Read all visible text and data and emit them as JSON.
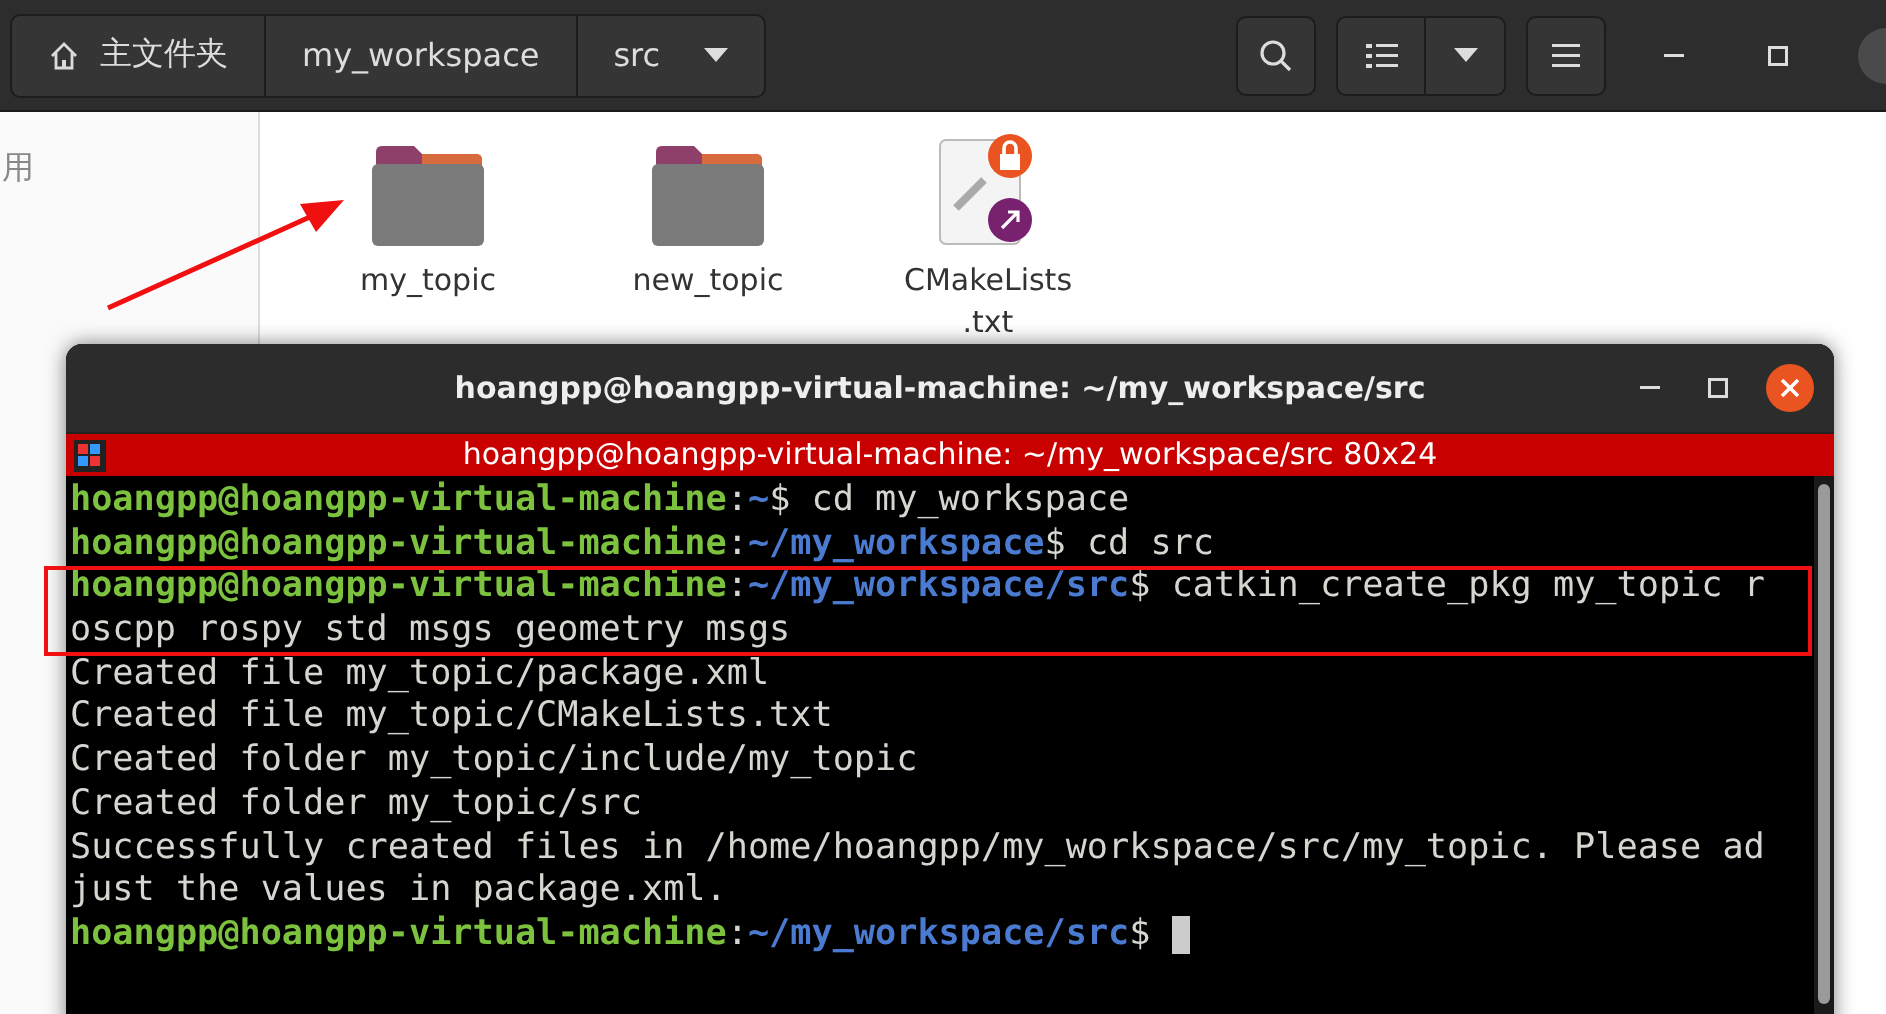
{
  "files_window": {
    "path": [
      {
        "label": "主文件夹",
        "kind": "home"
      },
      {
        "label": "my_workspace",
        "kind": "folder"
      },
      {
        "label": "src",
        "kind": "current"
      }
    ],
    "sidebar_items": [
      "用"
    ],
    "files": [
      {
        "name_lines": [
          "my_topic"
        ],
        "kind": "folder"
      },
      {
        "name_lines": [
          "new_topic"
        ],
        "kind": "folder"
      },
      {
        "name_lines": [
          "CMakeLists",
          ".txt"
        ],
        "kind": "text-link"
      }
    ]
  },
  "terminal": {
    "title": "hoangpp@hoangpp-virtual-machine: ~/my_workspace/src",
    "tab_title": "hoangpp@hoangpp-virtual-machine: ~/my_workspace/src 80x24",
    "lines": [
      {
        "kind": "prompt",
        "user": "hoangpp@hoangpp-virtual-machine",
        "sep": ":",
        "path": "~",
        "command": "$ cd my_workspace",
        "cursor": false
      },
      {
        "kind": "prompt",
        "user": "hoangpp@hoangpp-virtual-machine",
        "sep": ":",
        "path": "~/my_workspace",
        "command": "$ cd src",
        "cursor": false
      },
      {
        "kind": "prompt",
        "user": "hoangpp@hoangpp-virtual-machine",
        "sep": ":",
        "path": "~/my_workspace/src",
        "command": "$ catkin_create_pkg my_topic r",
        "cursor": false
      },
      {
        "kind": "output",
        "text": "oscpp rospy std msgs geometry msgs"
      },
      {
        "kind": "output",
        "text": "Created file my_topic/package.xml"
      },
      {
        "kind": "output",
        "text": "Created file my_topic/CMakeLists.txt"
      },
      {
        "kind": "output",
        "text": "Created folder my_topic/include/my_topic"
      },
      {
        "kind": "output",
        "text": "Created folder my_topic/src"
      },
      {
        "kind": "output",
        "text": "Successfully created files in /home/hoangpp/my_workspace/src/my_topic. Please ad"
      },
      {
        "kind": "output",
        "text": "just the values in package.xml."
      },
      {
        "kind": "prompt",
        "user": "hoangpp@hoangpp-virtual-machine",
        "sep": ":",
        "path": "~/my_workspace/src",
        "command": "$ ",
        "cursor": true
      }
    ]
  }
}
